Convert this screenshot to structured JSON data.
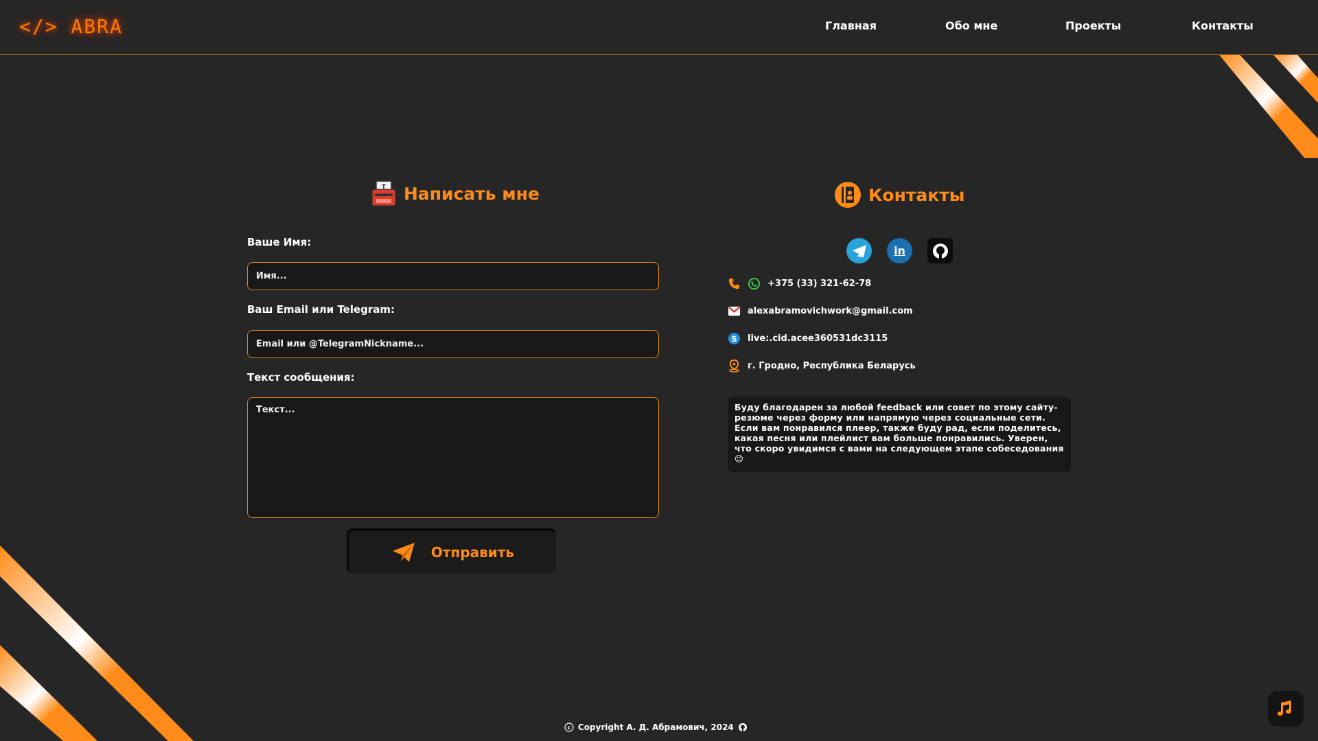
{
  "header": {
    "logo": "</> ABRA",
    "nav": [
      "Главная",
      "Обо мне",
      "Проекты",
      "Контакты"
    ]
  },
  "form": {
    "title": "Написать мне",
    "name_label": "Ваше Имя:",
    "name_placeholder": "Имя...",
    "email_label": "Ваш Email или Telegram:",
    "email_placeholder": "Email или @TelegramNickname...",
    "text_label": "Текст сообщения:",
    "text_placeholder": "Текст...",
    "submit": "Отправить"
  },
  "contacts": {
    "title": "Контакты",
    "socials": [
      "telegram-icon",
      "linkedin-icon",
      "github-icon"
    ],
    "phone": "+375 (33) 321-62-78",
    "email": "alexabramovichwork@gmail.com",
    "skype": "live:.cid.acee360531dc3115",
    "location": "г. Гродно, Республика Беларусь",
    "note": "Буду благодарен за любой feedback или совет по этому сайту-резюме через форму или напрямую через социальные сети. Если вам понравился плеер, также буду рад, если поделитесь, какая песня или плейлист вам больше понравились. Уверен, что скоро увидимся с вами на следующем этапе собеседования😉"
  },
  "footer": {
    "copyright": "Copyright А. Д. Абрамович, 2024"
  },
  "colors": {
    "accent": "#ff8c1a",
    "background": "#262626",
    "field_bg": "#181818",
    "border": "#d9881a"
  }
}
